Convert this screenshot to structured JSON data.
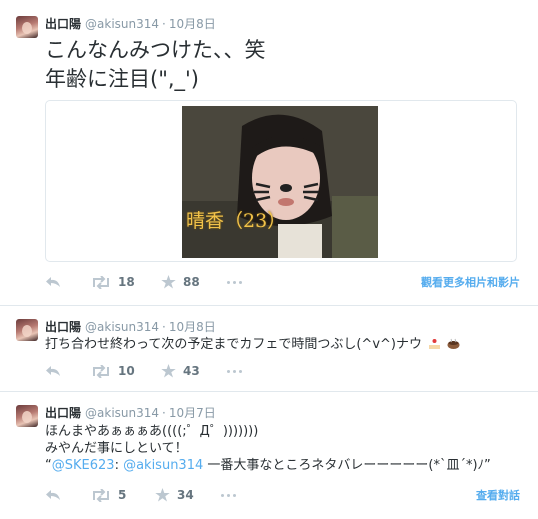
{
  "tweets": [
    {
      "name": "出口陽",
      "handle": "@akisun314",
      "time": "10月8日",
      "text_lines": [
        "こんなんみつけた、、笑",
        "年齢に注目(\",_')"
      ],
      "media_caption": "晴香（23）",
      "retweets": "18",
      "favorites": "88",
      "footer_link": "觀看更多相片和影片"
    },
    {
      "name": "出口陽",
      "handle": "@akisun314",
      "time": "10月8日",
      "text": "打ち合わせ終わって次の予定までカフェで時間つぶし(^v^)ナウ",
      "retweets": "10",
      "favorites": "43"
    },
    {
      "name": "出口陽",
      "handle": "@akisun314",
      "time": "10月7日",
      "line1": "ほんまやあぁぁぁあ((((;゜Д゜)))))))",
      "line2": "みやんだ事にしといて！",
      "quote_open": "“",
      "mention1": "@SKE623",
      "colon": ": ",
      "mention2": "@akisun314",
      "quote_rest": " 一番大事なところネタバレーーーーー(*`皿´*)ﾉ”",
      "retweets": "5",
      "favorites": "34",
      "footer_link": "查看對話"
    }
  ],
  "separator": "·"
}
